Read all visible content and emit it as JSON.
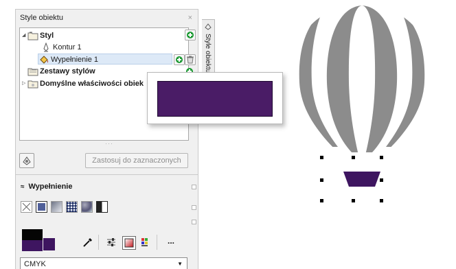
{
  "docker": {
    "title": "Style obiektu",
    "close_glyph": "×",
    "vertical_tab": "Style obiektu",
    "tree": [
      {
        "label": "Styl",
        "bold": true,
        "expander": "◢",
        "icon": "style-folder-icon"
      },
      {
        "label": "Kontur 1",
        "bold": false,
        "icon": "pen-outline-icon"
      },
      {
        "label": "Wypełnienie 1",
        "bold": false,
        "icon": "fill-bucket-icon",
        "selected": true
      },
      {
        "label": "Zestawy stylów",
        "bold": true,
        "icon": "styleset-folder-icon"
      },
      {
        "label": "Domyślne właściwości obiek",
        "bold": true,
        "expander": "▷",
        "icon": "default-props-icon"
      }
    ],
    "grip": "···",
    "apply_button": "Zastosuj do zaznaczonych"
  },
  "fill_section": {
    "title": "Wypełnienie",
    "chevron": "≈",
    "fill_types": [
      "no-fill",
      "uniform-fill",
      "fountain-fill",
      "pattern-fill",
      "texture-fill",
      "postscript-fill"
    ],
    "more_label": "...",
    "color_model": "CMYK",
    "dropdown_glyph": "▼"
  },
  "colors": {
    "fill_purple": "#3e1560",
    "popup_purple": "#4a1c66",
    "balloon_gray": "#8c8c8c",
    "green_add": "#1e9a35"
  }
}
